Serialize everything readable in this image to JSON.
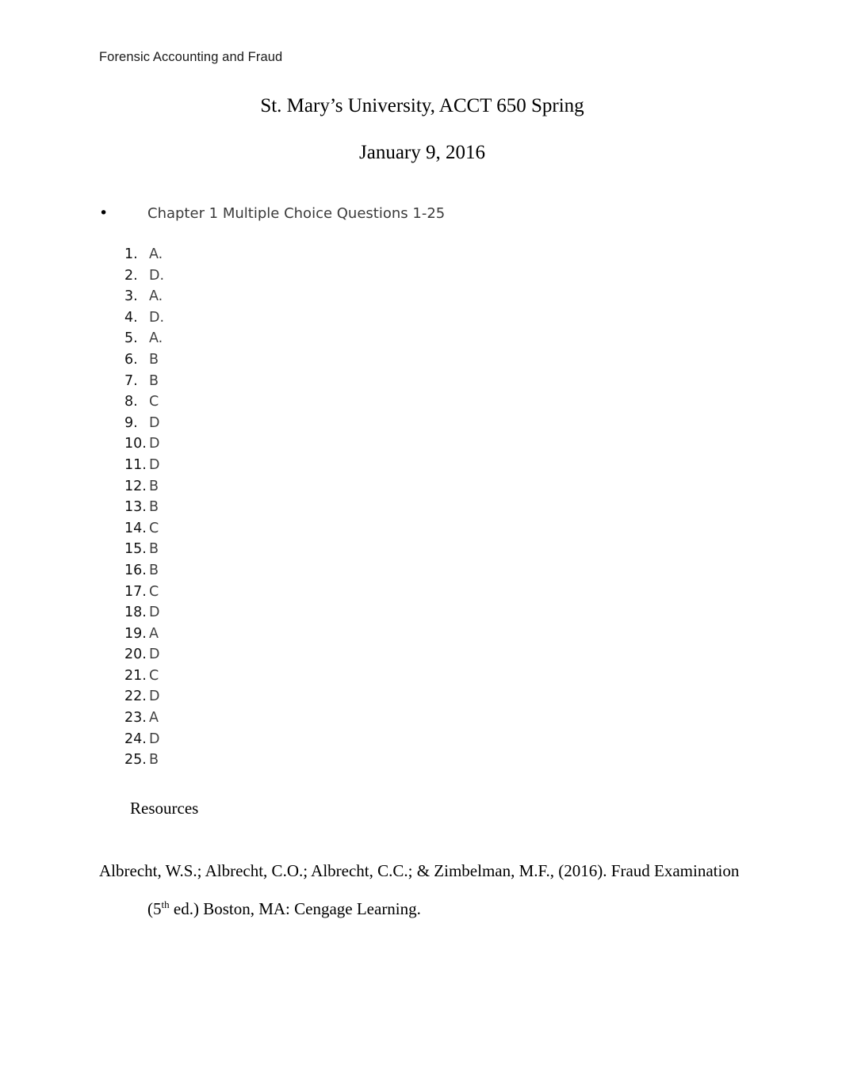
{
  "document": {
    "running_header": "Forensic Accounting and Fraud",
    "title_line_1": "St. Mary’s University, ACCT 650 Spring",
    "title_line_2": "January 9, 2016",
    "bullet": {
      "marker": "•",
      "text": "Chapter 1 Multiple Choice Questions 1-25"
    },
    "answers": [
      {
        "number": "1.",
        "value": "A."
      },
      {
        "number": "2.",
        "value": "D."
      },
      {
        "number": "3.",
        "value": "A."
      },
      {
        "number": "4.",
        "value": "D."
      },
      {
        "number": "5.",
        "value": "A."
      },
      {
        "number": "6.",
        "value": "B"
      },
      {
        "number": "7.",
        "value": "B"
      },
      {
        "number": "8.",
        "value": "C"
      },
      {
        "number": "9.",
        "value": "D"
      },
      {
        "number": "10.",
        "value": "D"
      },
      {
        "number": "11.",
        "value": "D"
      },
      {
        "number": "12.",
        "value": "B"
      },
      {
        "number": "13.",
        "value": "B"
      },
      {
        "number": "14.",
        "value": "C"
      },
      {
        "number": "15.",
        "value": "B"
      },
      {
        "number": "16.",
        "value": "B"
      },
      {
        "number": "17.",
        "value": "C"
      },
      {
        "number": "18.",
        "value": "D"
      },
      {
        "number": "19.",
        "value": "A"
      },
      {
        "number": "20.",
        "value": "D"
      },
      {
        "number": "21.",
        "value": "C"
      },
      {
        "number": "22.",
        "value": "D"
      },
      {
        "number": "23.",
        "value": "A"
      },
      {
        "number": "24.",
        "value": "D"
      },
      {
        "number": "25.",
        "value": "B"
      }
    ],
    "resources_heading": "Resources",
    "citation": {
      "line_1": "Albrecht, W.S.; Albrecht, C.O.; Albrecht, C.C.; & Zimbelman, M.F., (2016). Fraud Examination",
      "line_2_prefix": "(5",
      "line_2_superscript": "th",
      "line_2_suffix": " ed.) Boston, MA: Cengage Learning."
    }
  }
}
